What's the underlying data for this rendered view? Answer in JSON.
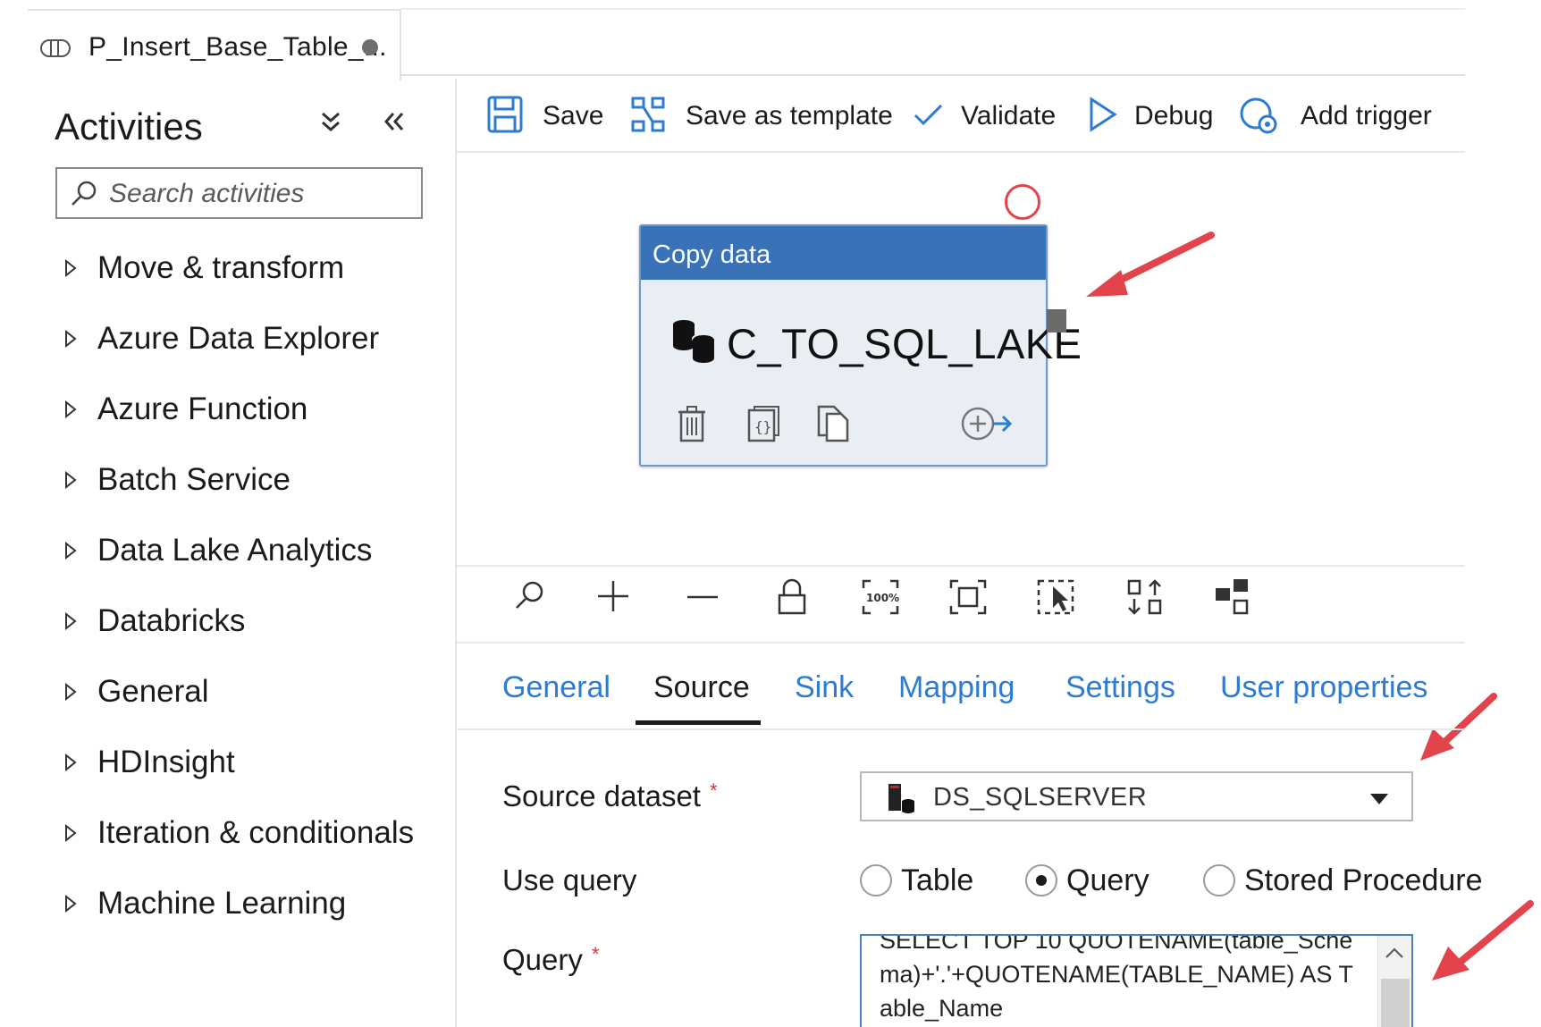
{
  "tab": {
    "title": "P_Insert_Base_Table_..."
  },
  "activities_panel": {
    "title": "Activities",
    "search_placeholder": "Search activities",
    "categories": [
      "Move & transform",
      "Azure Data Explorer",
      "Azure Function",
      "Batch Service",
      "Data Lake Analytics",
      "Databricks",
      "General",
      "HDInsight",
      "Iteration & conditionals",
      "Machine Learning"
    ]
  },
  "toolbar": {
    "save": "Save",
    "save_template": "Save as template",
    "validate": "Validate",
    "debug": "Debug",
    "add_trigger": "Add trigger"
  },
  "activity": {
    "type": "Copy data",
    "name": "C_TO_SQL_LAKE"
  },
  "canvas_tools": [
    "search-icon",
    "zoom-in-icon",
    "zoom-out-icon",
    "lock-icon",
    "zoom-100-icon",
    "fit-to-screen-icon",
    "select-icon",
    "auto-align-icon",
    "layout-icon"
  ],
  "property_tabs": [
    "General",
    "Source",
    "Sink",
    "Mapping",
    "Settings",
    "User properties"
  ],
  "active_tab": "Source",
  "form": {
    "source_dataset_label": "Source dataset",
    "source_dataset_value": "DS_SQLSERVER",
    "use_query_label": "Use query",
    "query_options": [
      "Table",
      "Query",
      "Stored Procedure"
    ],
    "selected_query_option": "Query",
    "query_label": "Query",
    "query_text": "SELECT TOP 10 QUOTENAME(table_Schema)+'.'+QUOTENAME(TABLE_NAME) AS Table_Name"
  },
  "colors": {
    "accent_blue": "#2e7bcf",
    "activity_header": "#3a72b8",
    "annotation_arrow": "#e3434b",
    "required_mark": "#d13438"
  }
}
